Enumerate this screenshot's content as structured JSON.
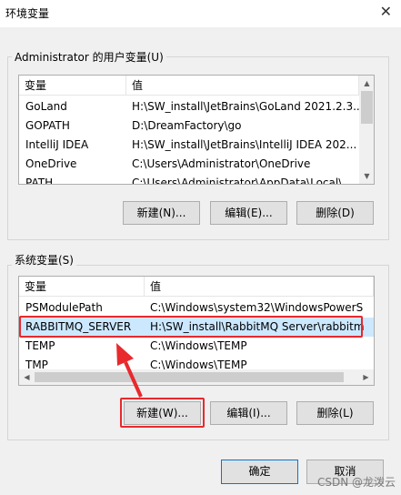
{
  "window": {
    "title": "环境变量",
    "close_glyph": "✕"
  },
  "user_vars": {
    "legend": "Administrator 的用户变量(U)",
    "columns": [
      "变量",
      "值"
    ],
    "rows": [
      {
        "name": "GoLand",
        "value": "H:\\SW_install\\JetBrains\\GoLand 2021.2.3..."
      },
      {
        "name": "GOPATH",
        "value": "D:\\DreamFactory\\go"
      },
      {
        "name": "IntelliJ IDEA",
        "value": "H:\\SW_install\\JetBrains\\IntelliJ IDEA 202..."
      },
      {
        "name": "OneDrive",
        "value": "C:\\Users\\Administrator\\OneDrive"
      },
      {
        "name": "PATH",
        "value": "C:\\Users\\Administrator\\AppData\\Local\\..."
      }
    ],
    "buttons": {
      "new": "新建(N)...",
      "edit": "编辑(E)...",
      "delete": "删除(D)"
    }
  },
  "system_vars": {
    "legend": "系统变量(S)",
    "columns": [
      "变量",
      "值"
    ],
    "rows": [
      {
        "name": "PSModulePath",
        "value": "C:\\Windows\\system32\\WindowsPowerS"
      },
      {
        "name": "RABBITMQ_SERVER",
        "value": "H:\\SW_install\\RabbitMQ Server\\rabbitm"
      },
      {
        "name": "TEMP",
        "value": "C:\\Windows\\TEMP"
      },
      {
        "name": "TMP",
        "value": "C:\\Windows\\TEMP"
      }
    ],
    "buttons": {
      "new": "新建(W)...",
      "edit": "编辑(I)...",
      "delete": "删除(L)"
    }
  },
  "footer": {
    "ok": "确定",
    "cancel": "取消"
  },
  "watermark": "CSDN @龙泼云",
  "colors": {
    "highlight": "#e8292d",
    "default_button_border": "#0078d7"
  },
  "icons": {
    "annotation": "red-arrow-icon"
  }
}
